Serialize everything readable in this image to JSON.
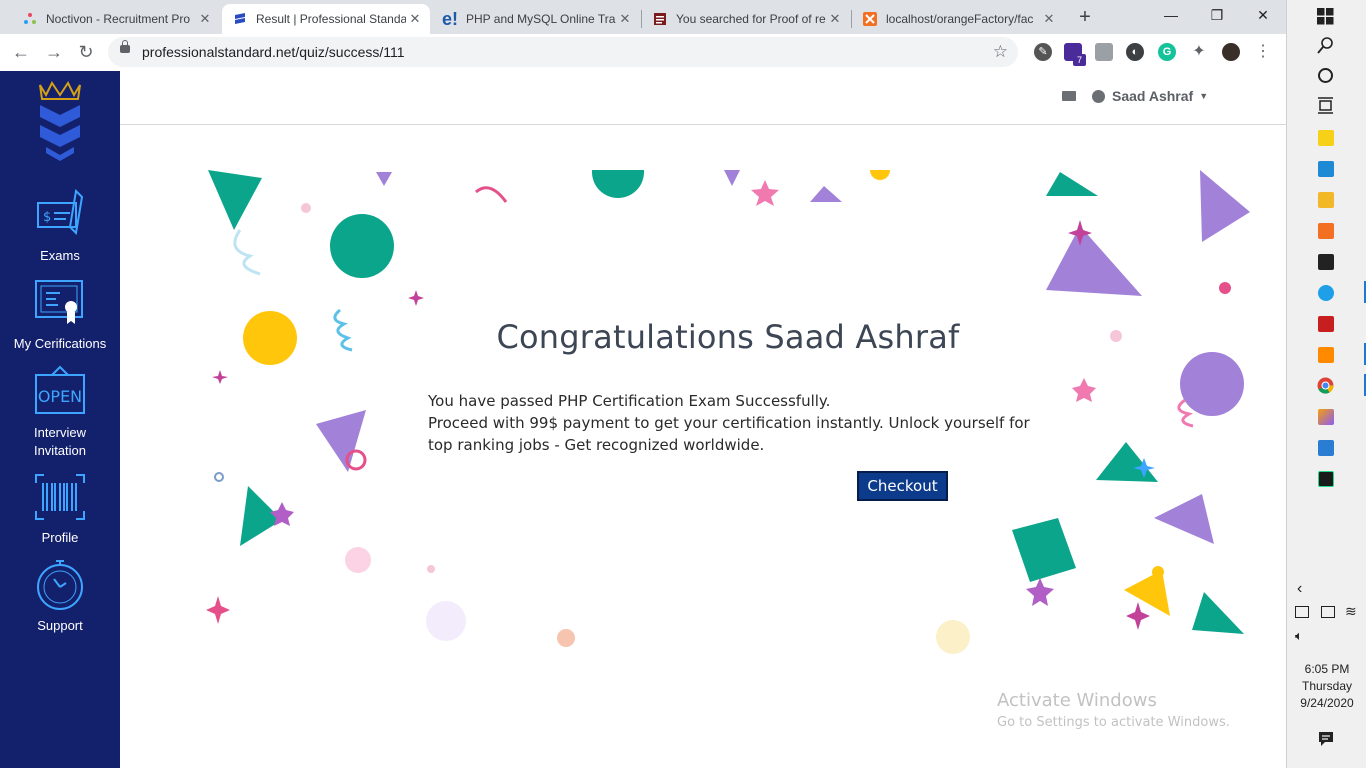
{
  "browser": {
    "tabs": [
      {
        "title": "Noctivon - Recruitment Pro",
        "icon": "noctivon-icon",
        "active": false
      },
      {
        "title": "Result | Professional Standa",
        "icon": "professional-standard-icon",
        "active": true
      },
      {
        "title": "PHP and MySQL Online Trai",
        "icon": "e-icon",
        "active": false
      },
      {
        "title": "You searched for Proof of re",
        "icon": "search-doc-icon",
        "active": false
      },
      {
        "title": "localhost/orangeFactory/fac",
        "icon": "xampp-icon",
        "active": false
      }
    ],
    "url": "professionalstandard.net/quiz/success/111",
    "extension_badge": "7"
  },
  "sidebar": {
    "items": [
      {
        "label": "Exams"
      },
      {
        "label": "My Cerifications"
      },
      {
        "label": "Interview Invitation"
      },
      {
        "label": "Profile"
      },
      {
        "label": "Support"
      }
    ],
    "open_sign_text": "OPEN"
  },
  "header": {
    "user_name": "Saad Ashraf"
  },
  "main": {
    "heading": "Congratulations Saad Ashraf",
    "line1": "You have passed PHP Certification Exam Successfully.",
    "line2": "Proceed with 99$ payment to get your certification instantly. Unlock yourself for top ranking jobs - Get recognized worldwide.",
    "checkout_label": "Checkout"
  },
  "watermark": {
    "title": "Activate Windows",
    "subtitle": "Go to Settings to activate Windows."
  },
  "taskbar": {
    "time": "6:05 PM",
    "day": "Thursday",
    "date": "9/24/2020"
  },
  "colors": {
    "sidebar": "#13206b",
    "teal": "#0aa58b",
    "purple": "#a182d8",
    "yellow": "#ffc60b",
    "pink": "#e6508a",
    "button": "#0d3b8c"
  }
}
